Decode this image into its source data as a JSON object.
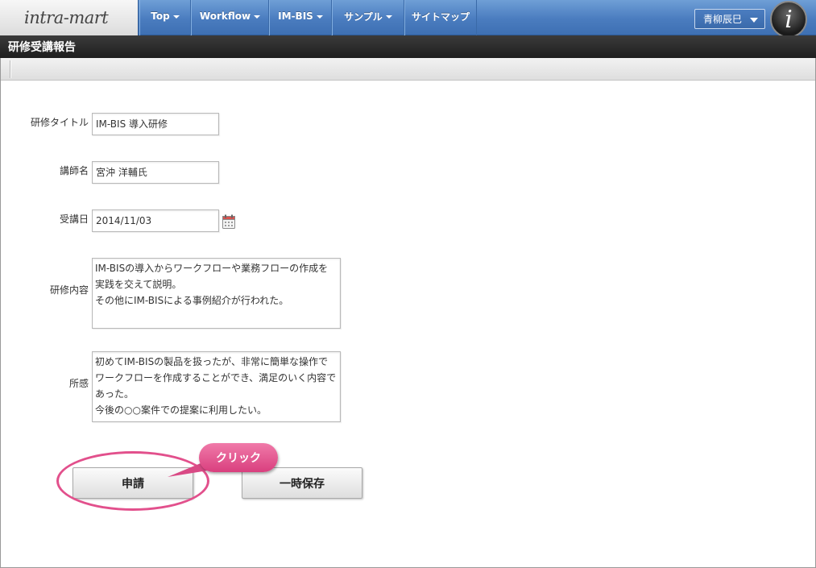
{
  "header": {
    "logo_text": "intra-mart",
    "nav": [
      {
        "label": "Top"
      },
      {
        "label": "Workflow"
      },
      {
        "label": "IM-BIS"
      },
      {
        "label": "サンプル"
      },
      {
        "label": "サイトマップ"
      }
    ],
    "user_name": "青柳辰巳",
    "user_logo_glyph": "i"
  },
  "page": {
    "title": "研修受講報告"
  },
  "form": {
    "training_title_label": "研修タイトル",
    "training_title_value": "IM-BIS 導入研修",
    "instructor_label": "講師名",
    "instructor_value": "宮沖  洋輔氏",
    "date_label": "受講日",
    "date_value": "2014/11/03",
    "content_label": "研修内容",
    "content_value": "IM-BISの導入からワークフローや業務フローの作成を\n実践を交えて説明。\nその他にIM-BISによる事例紹介が行われた。",
    "impression_label": "所感",
    "impression_value": "初めてIM-BISの製品を扱ったが、非常に簡単な操作で\nワークフローを作成することができ、満足のいく内容で\nあった。\n今後の○○案件での提案に利用したい。"
  },
  "buttons": {
    "apply_label": "申請",
    "save_draft_label": "一時保存"
  },
  "annotation": {
    "callout_text": "クリック",
    "highlight_color": "#e2508c"
  },
  "icons": {
    "calendar": "calendar-icon",
    "user_menu": "chevron-down-icon"
  },
  "colors": {
    "nav_bar": "#4a7cbf",
    "title_bar": "#2a2a2a",
    "accent_pink": "#e2508c"
  }
}
